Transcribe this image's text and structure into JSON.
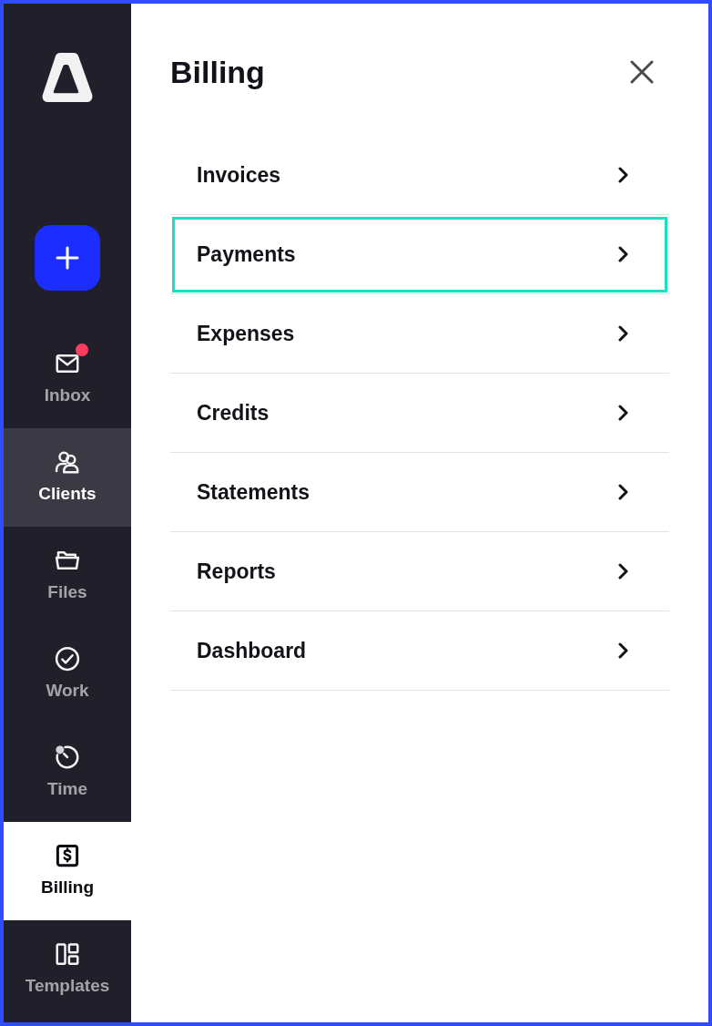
{
  "sidebar": {
    "items": [
      {
        "label": "Inbox",
        "selected": false,
        "highlighted": false,
        "notification": true
      },
      {
        "label": "Clients",
        "selected": false,
        "highlighted": true,
        "notification": false
      },
      {
        "label": "Files",
        "selected": false,
        "highlighted": false,
        "notification": false
      },
      {
        "label": "Work",
        "selected": false,
        "highlighted": false,
        "notification": false
      },
      {
        "label": "Time",
        "selected": false,
        "highlighted": false,
        "notification": false
      },
      {
        "label": "Billing",
        "selected": true,
        "highlighted": false,
        "notification": false
      },
      {
        "label": "Templates",
        "selected": false,
        "highlighted": false,
        "notification": false
      }
    ]
  },
  "panel": {
    "title": "Billing",
    "items": [
      {
        "label": "Invoices",
        "focused": false
      },
      {
        "label": "Payments",
        "focused": true
      },
      {
        "label": "Expenses",
        "focused": false
      },
      {
        "label": "Credits",
        "focused": false
      },
      {
        "label": "Statements",
        "focused": false
      },
      {
        "label": "Reports",
        "focused": false
      },
      {
        "label": "Dashboard",
        "focused": false
      }
    ]
  }
}
